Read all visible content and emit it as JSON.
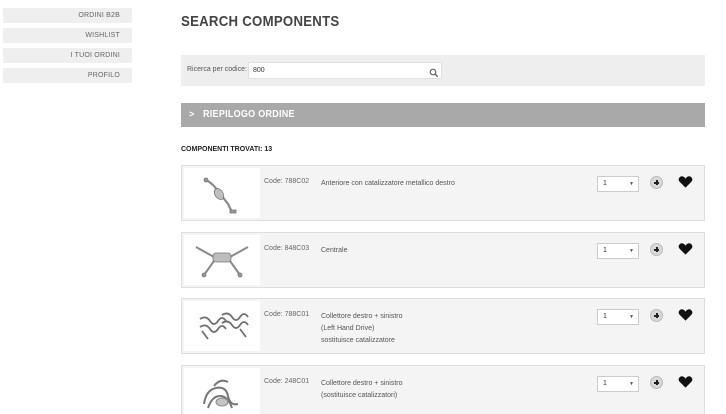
{
  "sidebar": {
    "items": [
      {
        "label": "ORDINI B2B"
      },
      {
        "label": "WISHLIST"
      },
      {
        "label": "I TUOI ORDINI"
      },
      {
        "label": "PROFILO"
      }
    ]
  },
  "page": {
    "title": "SEARCH COMPONENTS"
  },
  "search": {
    "label": "Ricerca per codice:",
    "value": "800",
    "icon": "search-icon"
  },
  "summary": {
    "label": "RIEPILOGO ORDINE",
    "icon": "chevron-right-icon"
  },
  "results": {
    "label": "COMPONENTI TROVATI: 13"
  },
  "products": [
    {
      "code": "Code: 788C02",
      "desc": [
        "Anteriore con catalizzatore metallico destro"
      ],
      "qty": "1",
      "image": "front-pipe-catalyst"
    },
    {
      "code": "Code: 848C03",
      "desc": [
        "Centrale"
      ],
      "qty": "1",
      "image": "central-x-pipe"
    },
    {
      "code": "Code: 788C01",
      "desc": [
        "Collettore destro + sinistro",
        "(Left Hand Drive)",
        "sostituisce catalizzatore"
      ],
      "qty": "1",
      "image": "headers-pair"
    },
    {
      "code": "Code: 248C01",
      "desc": [
        "Collettore destro + sinistro",
        "(sostituisce catalizzatori)"
      ],
      "qty": "1",
      "image": "manifold"
    }
  ],
  "colors": {
    "sidebar_bg": "#efefef",
    "summary_bar": "#a9a9a9",
    "card_bg": "#f4f4f4",
    "search_bg": "#eeeeee"
  }
}
